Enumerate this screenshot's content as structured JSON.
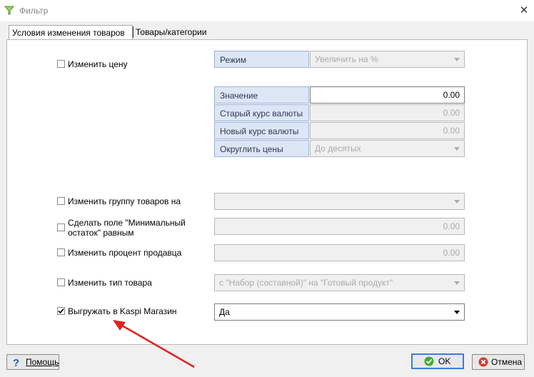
{
  "window": {
    "title": "Фильтр",
    "close_icon": "close-icon"
  },
  "tabs": [
    {
      "label": "Условия изменения товаров",
      "active": true
    },
    {
      "label": "Товары/категории",
      "active": false
    }
  ],
  "price": {
    "checkbox_label": "Изменить цену",
    "checked": false,
    "mode_label": "Режим",
    "mode_value": "Увеличить на %",
    "value_label": "Значение",
    "value": "0.00",
    "old_rate_label": "Старый курс валюты",
    "old_rate_value": "0.00",
    "new_rate_label": "Новый курс валюты",
    "new_rate_value": "0.00",
    "round_label": "Округлить цены",
    "round_value": "До десятых"
  },
  "options": {
    "group": {
      "label": "Изменить группу товаров на",
      "checked": false,
      "value": ""
    },
    "min_stock": {
      "label_line1": "Сделать поле \"Минимальный",
      "label_line2": "остаток\" равным",
      "checked": false,
      "value": "0.00"
    },
    "seller_pct": {
      "label": "Изменить процент продавца",
      "checked": false,
      "value": "0.00"
    },
    "type": {
      "label": "Изменить тип товара",
      "checked": false,
      "value": "с \"Набор (составной)\" на \"Готовый продукт\""
    },
    "kaspi": {
      "label": "Выгружать в Kaspi Магазин",
      "checked": true,
      "value": "Да"
    }
  },
  "buttons": {
    "help": "Помощь",
    "ok": "OK",
    "cancel": "Отмена"
  },
  "colors": {
    "annotation_arrow": "#e02020",
    "focus_border": "#3c7fd1",
    "ok_icon": "#3fae2a",
    "cancel_icon": "#d23a2a"
  }
}
